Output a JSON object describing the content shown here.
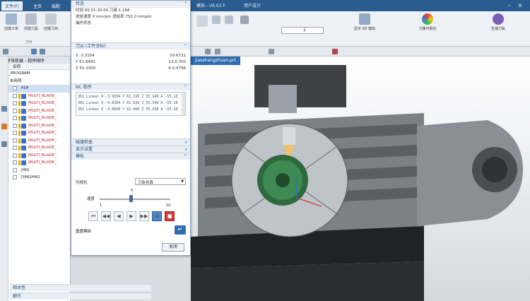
{
  "titlebar": {
    "tabs": [
      "文件(F)",
      "主页",
      "装配"
    ],
    "title": "模拟 - V6.03 F",
    "title_right": "用户设计"
  },
  "ribbon": {
    "groups": [
      "刀片"
    ],
    "buttons_left": [
      "创建工序",
      "创建刀具",
      "创建几何"
    ],
    "buttons_right": [
      "显示 3D 模拟",
      "刀路可视化",
      "生成刀轨"
    ],
    "spin_value": "1"
  },
  "navigator": {
    "header": "工序导航器 - 程序顺序",
    "col_header": "名称",
    "rows": [
      {
        "label": "NC_PROGRAM",
        "type": "root"
      },
      {
        "label": "未用项",
        "type": "group"
      },
      {
        "label": "PDF",
        "type": "group-selected"
      },
      {
        "label": "MULTI_BLADE_",
        "type": "op"
      },
      {
        "label": "MULTI_BLADE_",
        "type": "op"
      },
      {
        "label": "MULTI_BLADE_",
        "type": "op"
      },
      {
        "label": "MULTI_BLADE_",
        "type": "op"
      },
      {
        "label": "MULTI_BLADE_",
        "type": "op"
      },
      {
        "label": "MULTI_BLADE_",
        "type": "op"
      },
      {
        "label": "MULTI_BLADE_",
        "type": "op"
      },
      {
        "label": "MULTI_BLADE_",
        "type": "op"
      },
      {
        "label": "MULTI_BLADE_",
        "type": "op"
      },
      {
        "label": "MULTI_BLADE_",
        "type": "op"
      },
      {
        "label": "JING",
        "type": "sub"
      },
      {
        "label": "DINGHAO",
        "type": "sub"
      }
    ]
  },
  "dialog": {
    "status_header": "状态",
    "status_lines": [
      "时间 00:01:30:00 刀具 1.168",
      "进给速度 0 mm/pm  进给率 750.0 mmpm",
      "操作状态"
    ],
    "tool_header": "刀尖 (工件坐标)",
    "coords": [
      {
        "axis": "X",
        "label": "X -3.3104",
        "value": "10.6731"
      },
      {
        "axis": "Y",
        "label": "Y 61.8492",
        "value": "13.0.700"
      },
      {
        "axis": "Z",
        "label": "Z 55.3300",
        "value": "K 0.5798"
      }
    ],
    "nc_header": "NC 程序",
    "nc_lines": [
      "361 Linear X -3.9104 Y 61.199 Z 55.140 A -55.10",
      "361 Linear X -4.8384 Y 61.639 Z 55.340 A -55.10",
      "363 Linear X -4.8608 Y 61.860 Z 55.336 A -55.20"
    ],
    "collapsed_sections": [
      "碰撞检查",
      "显示设置"
    ],
    "sim_header": "模拟",
    "visualize_label": "可视化",
    "visualize_value": "刀轨仿真",
    "speed_label": "速度",
    "speed_min": "1",
    "speed_max": "10",
    "speed_current": "5",
    "playback": [
      "⏮",
      "◀◀",
      "◀",
      "▶",
      "▶▶",
      "⏭",
      "■"
    ],
    "reset_label": "重置模拟",
    "close_label": "关闭"
  },
  "viewport": {
    "tab_label": "jiaoshangzhuan.prt"
  },
  "bottom": [
    "相关性",
    "细节"
  ]
}
